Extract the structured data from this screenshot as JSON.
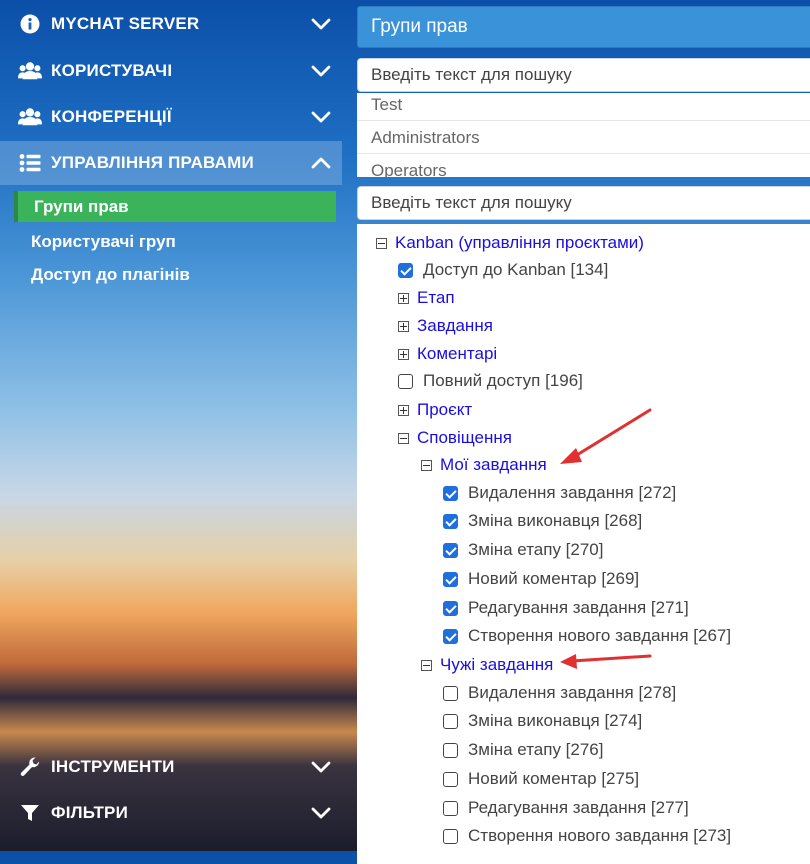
{
  "sidebar": {
    "top_items": [
      {
        "label": "MYCHAT SERVER",
        "icon": "info-icon"
      },
      {
        "label": "КОРИСТУВАЧІ",
        "icon": "users-icon"
      },
      {
        "label": "КОНФЕРЕНЦІЇ",
        "icon": "users-icon"
      },
      {
        "label": "УПРАВЛІННЯ ПРАВАМИ",
        "icon": "list-icon"
      }
    ],
    "sub_items": [
      {
        "label": "Групи прав",
        "selected": true
      },
      {
        "label": "Користувачі груп"
      },
      {
        "label": "Доступ до плагінів"
      }
    ],
    "bottom_items": [
      {
        "label": "ІНСТРУМЕНТИ",
        "icon": "wrench-icon"
      },
      {
        "label": "ФІЛЬТРИ",
        "icon": "filter-icon"
      }
    ]
  },
  "main": {
    "title": "Групи прав",
    "search1_placeholder": "Введіть текст для пошуку",
    "groups": [
      "Test",
      "Administrators",
      "Operators"
    ],
    "search2_placeholder": "Введіть текст для пошуку",
    "tree": {
      "root": "Kanban (управління проєктами)",
      "access": "Доступ до Kanban [134]",
      "stage": "Етап",
      "tasks": "Завдання",
      "comments": "Коментарі",
      "full_access": "Повний доступ [196]",
      "project": "Проєкт",
      "notifications": "Сповіщення",
      "my_tasks": {
        "label": "Мої завдання",
        "items": [
          "Видалення завдання [272]",
          "Зміна виконавця [268]",
          "Зміна етапу [270]",
          "Новий коментар [269]",
          "Редагування завдання [271]",
          "Створення нового завдання [267]"
        ]
      },
      "others_tasks": {
        "label": "Чужі завдання",
        "items": [
          "Видалення завдання [278]",
          "Зміна виконавця [274]",
          "Зміна етапу [276]",
          "Новий коментар [275]",
          "Редагування завдання [277]",
          "Створення нового завдання [273]"
        ]
      }
    }
  },
  "colors": {
    "header": "#3a93d8",
    "selected_sub": "#3bb35b",
    "link": "#1a0fe0",
    "checkbox": "#1f6fdc",
    "arrow": "#e03030"
  }
}
